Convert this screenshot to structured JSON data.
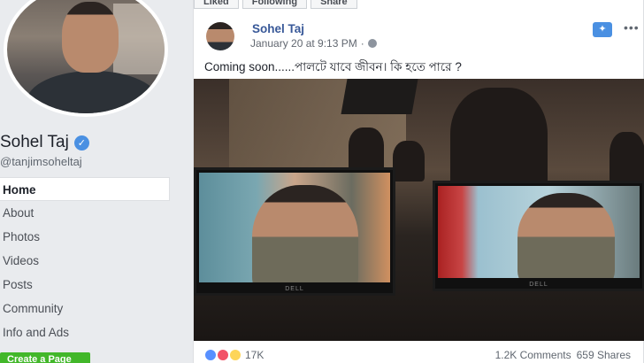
{
  "sidebar": {
    "page_name": "Sohel Taj",
    "verified_icon": "check-icon",
    "handle": "@tanjimsoheltaj",
    "items": [
      {
        "label": "Home"
      },
      {
        "label": "About"
      },
      {
        "label": "Photos"
      },
      {
        "label": "Videos"
      },
      {
        "label": "Posts"
      },
      {
        "label": "Community"
      },
      {
        "label": "Info and Ads"
      }
    ],
    "create_label": "Create a Page"
  },
  "top_actions": {
    "liked_label": "Liked",
    "following_label": "Following",
    "share_label": "Share"
  },
  "post": {
    "author": "Sohel Taj",
    "timestamp": "January 20 at 9:13 PM",
    "text": "Coming soon......পালটে যাবে জীবন। কি হতে পারে ?",
    "monitor_brand": "DELL"
  },
  "footer": {
    "reaction_count": "17K",
    "comments": "1.2K Comments",
    "shares": "659 Shares"
  },
  "colors": {
    "link": "#385898",
    "accent": "#4a90e2",
    "create_button": "#42b72a"
  }
}
